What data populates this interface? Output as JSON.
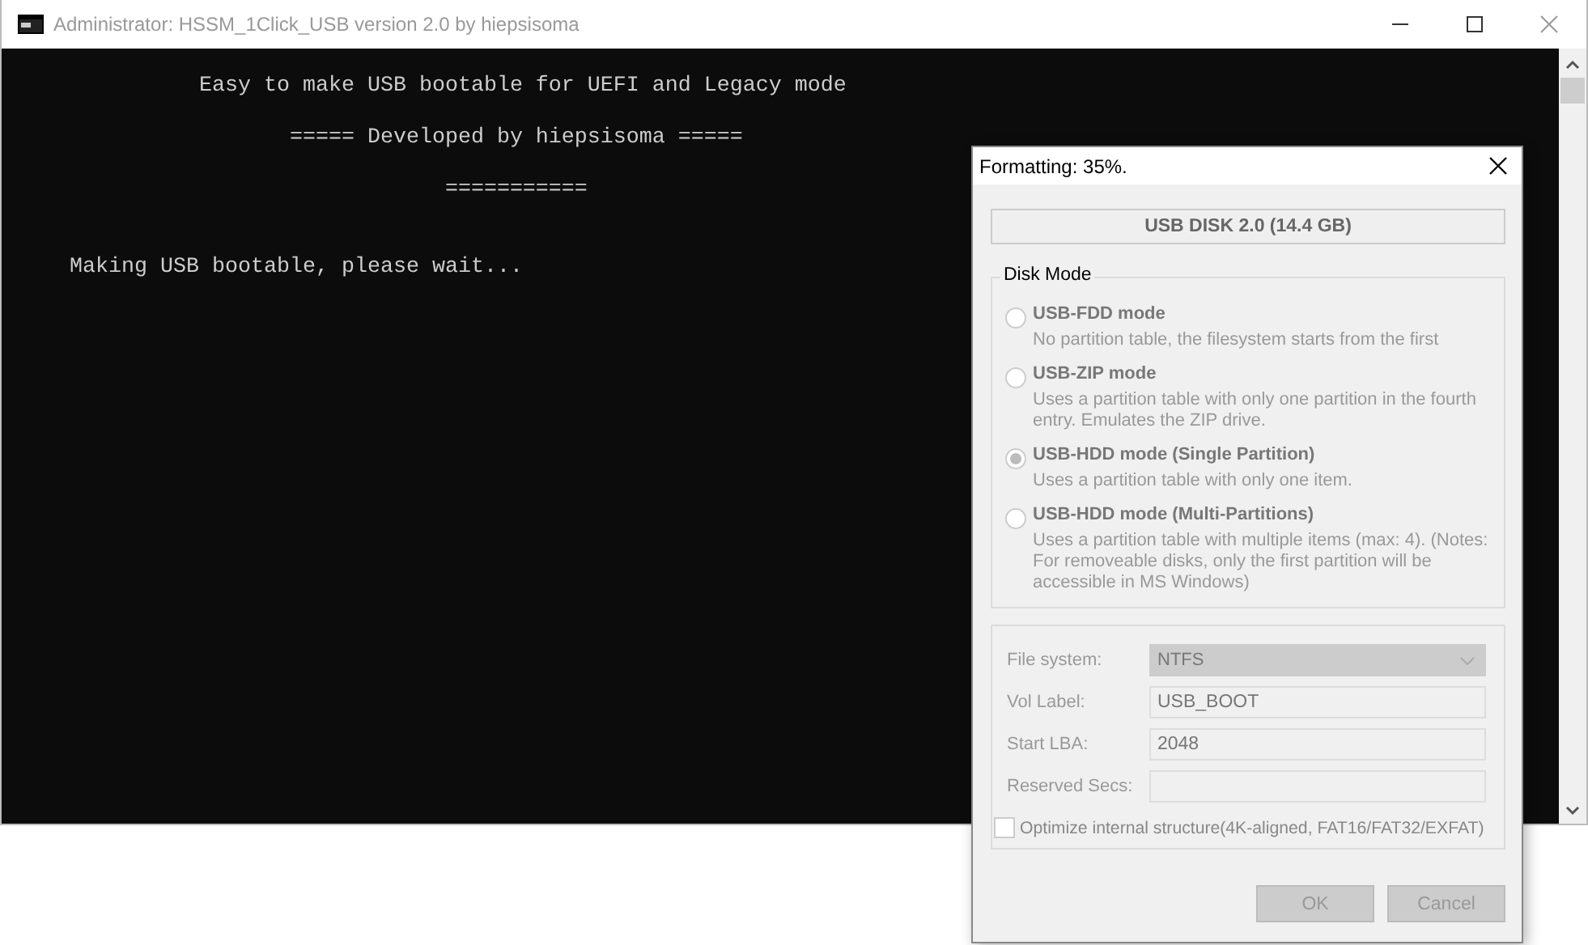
{
  "console_window": {
    "title": "Administrator:  HSSM_1Click_USB version 2.0 by hiepsisoma",
    "banner": [
      "          Easy to make USB bootable for UEFI and Legacy mode",
      "                 ===== Developed by hiepsisoma =====",
      "                             ==========="
    ],
    "message": "Making USB bootable, please wait..."
  },
  "dialog": {
    "title": "Formatting: 35%.",
    "disabled": true,
    "device": "USB DISK 2.0 (14.4 GB)",
    "disk_mode": {
      "title": "Disk Mode",
      "options": [
        {
          "label": "USB-FDD mode",
          "description": "No partition table, the filesystem starts from the first",
          "selected": false
        },
        {
          "label": "USB-ZIP mode",
          "description": "Uses a partition table with only one partition in the fourth entry. Emulates the ZIP drive.",
          "selected": false
        },
        {
          "label": "USB-HDD mode (Single Partition)",
          "description": "Uses a partition table with only one item.",
          "selected": true
        },
        {
          "label": "USB-HDD mode (Multi-Partitions)",
          "description": "Uses a partition table with multiple items (max: 4). (Notes: For removeable disks, only the first partition will be accessible in MS Windows)",
          "selected": false
        }
      ]
    },
    "fields": [
      {
        "label": "File system:",
        "kind": "dropdown",
        "value": "NTFS"
      },
      {
        "label": "Vol Label:",
        "kind": "text",
        "value": "USB_BOOT"
      },
      {
        "label": "Start LBA:",
        "kind": "text",
        "value": "2048"
      },
      {
        "label": "Reserved Secs:",
        "kind": "text"
      }
    ],
    "optimize": {
      "label": "Optimize internal structure(4K-aligned, FAT16/FAT32/EXFAT)",
      "checked": false
    },
    "buttons": [
      "OK",
      "Cancel"
    ]
  }
}
